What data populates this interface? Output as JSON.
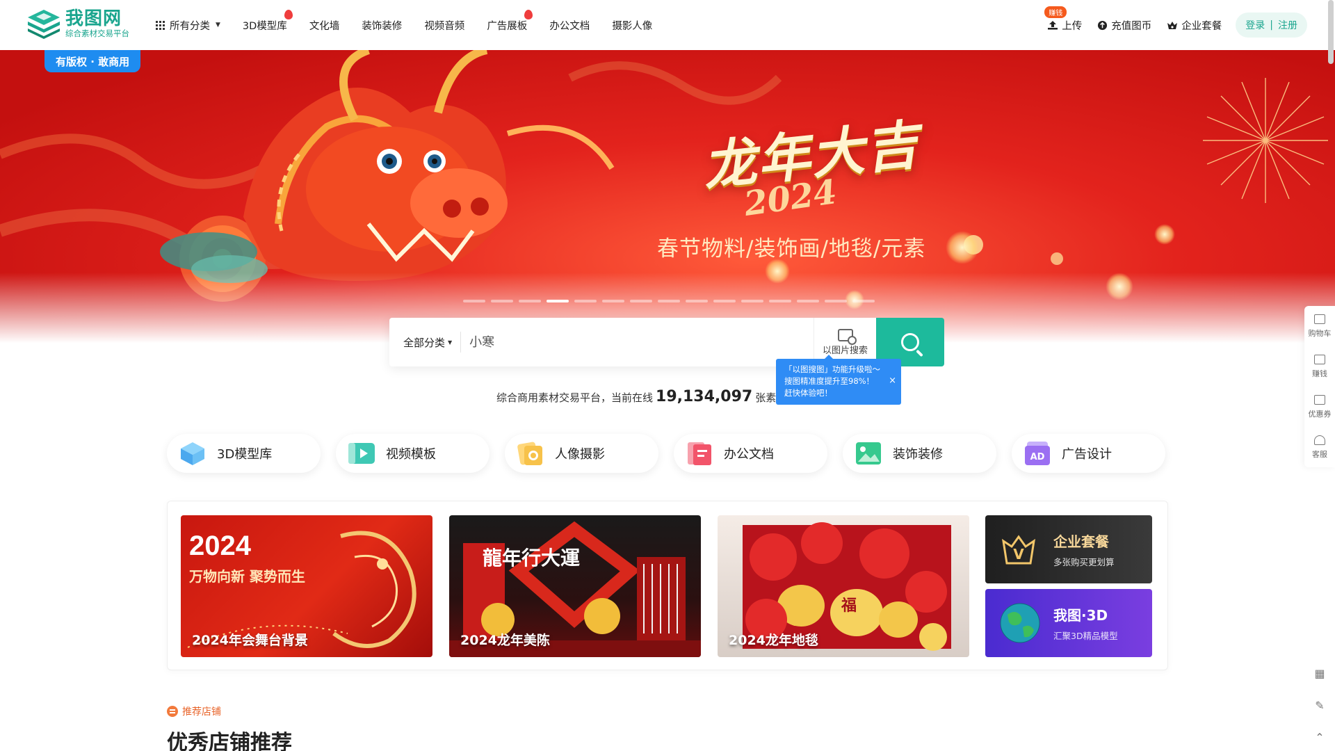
{
  "logo": {
    "name": "我图网",
    "tagline": "综合素材交易平台"
  },
  "nav": {
    "all_categories": "所有分类",
    "items": [
      {
        "label": "3D模型库",
        "hot": true
      },
      {
        "label": "文化墙",
        "hot": false
      },
      {
        "label": "装饰装修",
        "hot": false
      },
      {
        "label": "视频音频",
        "hot": false
      },
      {
        "label": "广告展板",
        "hot": true
      },
      {
        "label": "办公文档",
        "hot": false
      },
      {
        "label": "摄影人像",
        "hot": false
      }
    ]
  },
  "right_nav": {
    "earn_tag": "赚钱",
    "upload": "上传",
    "recharge": "充值图币",
    "enterprise": "企业套餐",
    "login": "登录",
    "register": "注册"
  },
  "banner": {
    "copyright_tag": "有版权 · 敢商用",
    "title": "龙年大吉",
    "year": "2024",
    "subtitle": "春节物料/装饰画/地毯/元素",
    "slide_count": 15,
    "active_slide": 3
  },
  "search": {
    "category": "全部分类",
    "placeholder": "小寒",
    "image_search_label": "以图片搜索",
    "tooltip_line1": "「以图搜图」功能升级啦～",
    "tooltip_line2": "搜图精准度提升至98%！",
    "tooltip_line3": "赶快体验吧！",
    "tooltip_close": "×"
  },
  "stats": {
    "prefix": "综合商用素材交易平台，当前在线",
    "count": "19,134,097",
    "suffix": "张素材"
  },
  "categories": [
    {
      "label": "3D模型库",
      "icon": "cube-icon",
      "color": "#5bb8f5"
    },
    {
      "label": "视频模板",
      "icon": "video-icon",
      "color": "#3fc8b4"
    },
    {
      "label": "人像摄影",
      "icon": "camera-icon",
      "color": "#f7c24a"
    },
    {
      "label": "办公文档",
      "icon": "document-icon",
      "color": "#f2546a"
    },
    {
      "label": "装饰装修",
      "icon": "picture-icon",
      "color": "#36c98e"
    },
    {
      "label": "广告设计",
      "icon": "ad-icon",
      "color": "#9b6ff2"
    }
  ],
  "promos": [
    {
      "label": "2024年会舞台背景",
      "headline": "2024",
      "tagline": "万物向新 聚势而生"
    },
    {
      "label": "2024龙年美陈",
      "headline": "龍年行大運"
    },
    {
      "label": "2024龙年地毯",
      "headline": "福"
    }
  ],
  "side_cards": [
    {
      "title": "企业套餐",
      "sub": "多张购买更划算",
      "icon": "v-crown-icon"
    },
    {
      "title": "我图·3D",
      "sub": "汇聚3D精品模型",
      "icon": "globe-icon"
    }
  ],
  "recommend": {
    "tag": "推荐店铺",
    "title": "优秀店铺推荐"
  },
  "sidebar": [
    {
      "label": "购物车",
      "icon": "cart-icon"
    },
    {
      "label": "赚钱",
      "icon": "shop-icon"
    },
    {
      "label": "优惠券",
      "icon": "coupon-icon"
    },
    {
      "label": "客服",
      "icon": "headset-icon"
    }
  ],
  "sidebar_bottom": [
    {
      "icon": "qrcode-icon",
      "glyph": "▦"
    },
    {
      "icon": "edit-icon",
      "glyph": "✎"
    },
    {
      "icon": "back-to-top-icon",
      "glyph": "⌃"
    }
  ],
  "colors": {
    "brand": "#1aa58e",
    "search_button": "#1dba9c",
    "banner_red": "#e3231d",
    "tooltip_blue": "#2f8cf5",
    "copyright_blue": "#1e8cf0",
    "side_card_dark": "#2c2c2c",
    "side_card_purple": "#6b36d8"
  }
}
